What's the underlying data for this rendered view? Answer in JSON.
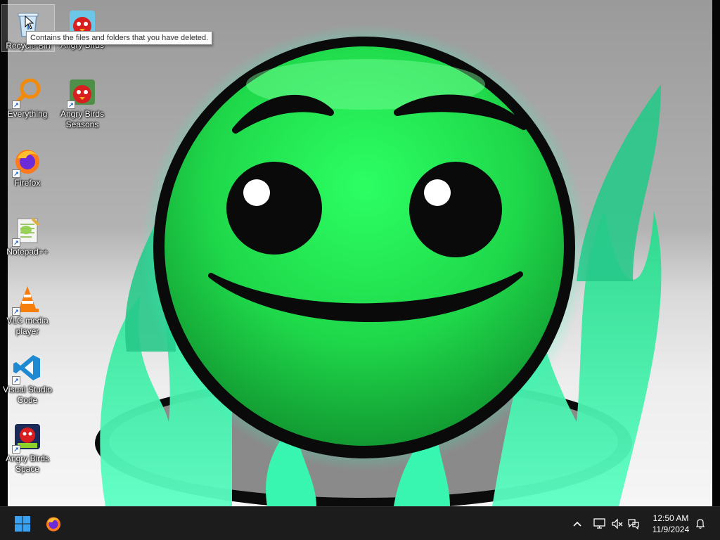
{
  "desktop": {
    "icons": [
      {
        "label": "Recycle Bin",
        "icon": "recycle-bin-icon"
      },
      {
        "label": "Angry Birds",
        "icon": "angry-birds-icon"
      },
      {
        "label": "Everything",
        "icon": "everything-search-icon"
      },
      {
        "label": "Angry Birds Seasons",
        "icon": "angry-birds-seasons-icon"
      },
      {
        "label": "Firefox",
        "icon": "firefox-icon"
      },
      {
        "label": "Notepad++",
        "icon": "notepad-plus-plus-icon"
      },
      {
        "label": "VLC media player",
        "icon": "vlc-icon"
      },
      {
        "label": "Visual Studio Code",
        "icon": "vscode-icon"
      },
      {
        "label": "Angry Birds Space",
        "icon": "angry-birds-space-icon"
      }
    ],
    "tooltip": "Contains the files and folders that you have deleted."
  },
  "taskbar": {
    "start_icon": "windows-start-icon",
    "pinned": [
      {
        "name": "Firefox",
        "icon": "firefox-icon"
      }
    ],
    "tray": {
      "chevron_icon": "chevron-up-icon",
      "network_icon": "network-icon",
      "volume_icon": "volume-muted-icon",
      "chat_icon": "chat-icon",
      "notification_icon": "bell-icon"
    },
    "clock": {
      "time": "12:50 AM",
      "date": "11/9/2024"
    }
  },
  "colors": {
    "face_green": "#22e05a",
    "flame_green": "#2ef0a0",
    "taskbar": "#1c1c1c"
  }
}
